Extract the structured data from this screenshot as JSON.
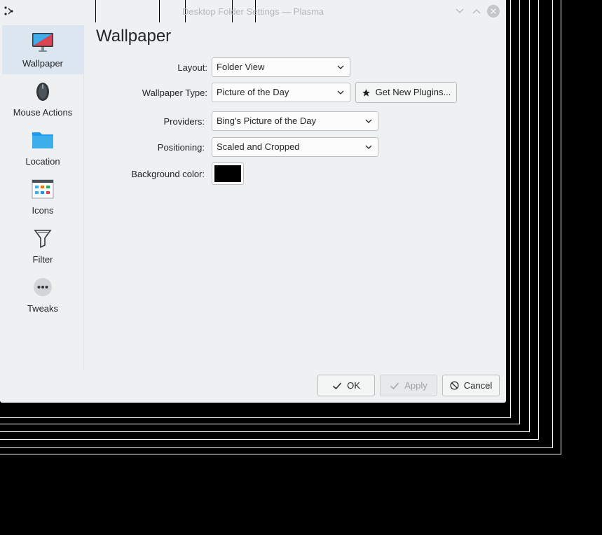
{
  "window": {
    "title": "Desktop Folder Settings — Plasma"
  },
  "sidebar": {
    "items": [
      {
        "label": "Wallpaper",
        "icon": "monitor-wallpaper-icon",
        "active": true
      },
      {
        "label": "Mouse Actions",
        "icon": "mouse-icon",
        "active": false
      },
      {
        "label": "Location",
        "icon": "folder-icon",
        "active": false
      },
      {
        "label": "Icons",
        "icon": "icons-window-icon",
        "active": false
      },
      {
        "label": "Filter",
        "icon": "filter-funnel-icon",
        "active": false
      },
      {
        "label": "Tweaks",
        "icon": "more-dots-icon",
        "active": false
      }
    ]
  },
  "page": {
    "heading": "Wallpaper",
    "layout_label": "Layout:",
    "layout_value": "Folder View",
    "wallpaper_type_label": "Wallpaper Type:",
    "wallpaper_type_value": "Picture of the Day",
    "get_plugins_label": "Get New Plugins...",
    "providers_label": "Providers:",
    "providers_value": "Bing's Picture of the Day",
    "positioning_label": "Positioning:",
    "positioning_value": "Scaled and Cropped",
    "background_color_label": "Background color:",
    "background_color": "#000000"
  },
  "footer": {
    "ok_label": "OK",
    "apply_label": "Apply",
    "cancel_label": "Cancel"
  },
  "colors": {
    "accent": "#3daee9",
    "window_bg": "#eff0f1",
    "selected_bg": "#dbe6f0"
  }
}
